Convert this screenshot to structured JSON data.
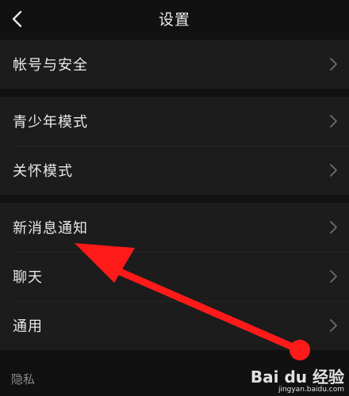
{
  "header": {
    "title": "设置"
  },
  "groups": [
    {
      "items": [
        {
          "label": "帐号与安全"
        }
      ]
    },
    {
      "items": [
        {
          "label": "青少年模式"
        },
        {
          "label": "关怀模式"
        }
      ]
    },
    {
      "items": [
        {
          "label": "新消息通知"
        },
        {
          "label": "聊天"
        },
        {
          "label": "通用"
        }
      ]
    }
  ],
  "section": {
    "privacy_label": "隐私"
  },
  "watermark": {
    "brand": "Bai du 经验",
    "url": "jingyan.baidu.com"
  },
  "colors": {
    "background": "#111111",
    "row": "#1c1c1c",
    "annotation_arrow": "#ff1a1a"
  },
  "icons": {
    "back": "chevron-left-icon",
    "row_arrow": "chevron-right-icon"
  }
}
